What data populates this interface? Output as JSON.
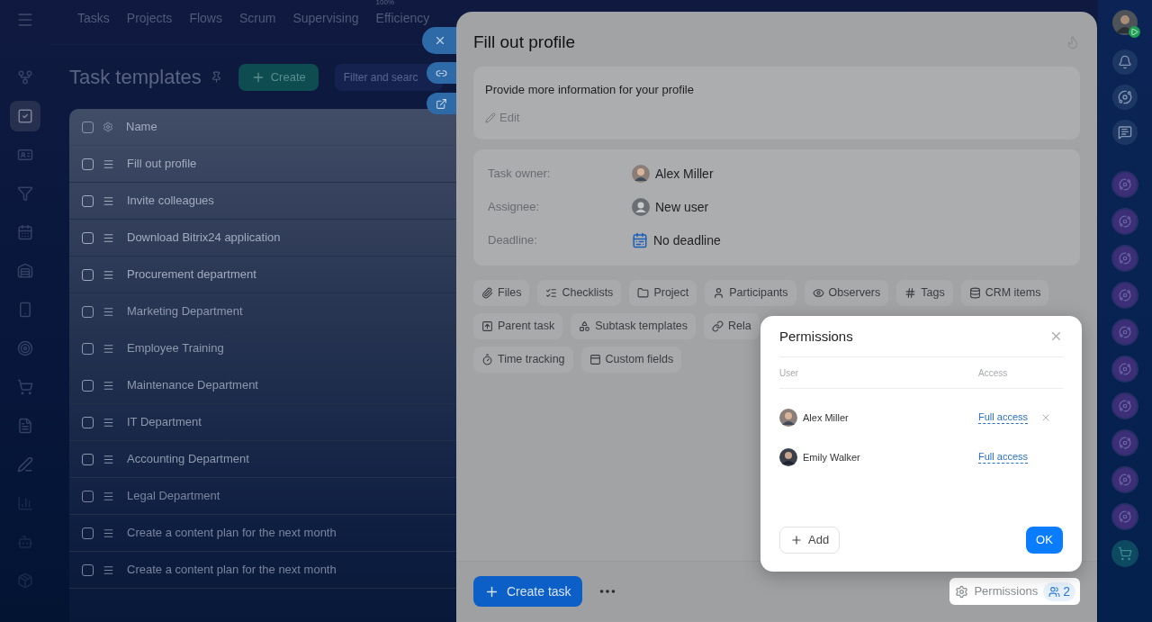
{
  "left_sidebar": {
    "items": [
      {
        "kind": "flow",
        "selected": false
      },
      {
        "kind": "tasks",
        "selected": true
      },
      {
        "kind": "card",
        "selected": false
      },
      {
        "kind": "funnel",
        "selected": false
      },
      {
        "kind": "calendar",
        "selected": false
      },
      {
        "kind": "store",
        "selected": false
      },
      {
        "kind": "phone",
        "selected": false
      },
      {
        "kind": "target",
        "selected": false
      },
      {
        "kind": "cart",
        "selected": false
      },
      {
        "kind": "doc",
        "selected": false
      },
      {
        "kind": "pen",
        "selected": false
      },
      {
        "kind": "chart",
        "selected": false
      },
      {
        "kind": "robot",
        "selected": false
      },
      {
        "kind": "box",
        "selected": false
      }
    ]
  },
  "top_nav": {
    "items": [
      {
        "label": "Tasks"
      },
      {
        "label": "Projects"
      },
      {
        "label": "Flows"
      },
      {
        "label": "Scrum"
      },
      {
        "label": "Supervising"
      },
      {
        "label": "Efficiency",
        "badge": "100%"
      }
    ]
  },
  "page": {
    "title": "Task templates",
    "create_button": "Create",
    "search": {
      "placeholder": "Filter and searc"
    }
  },
  "table": {
    "columns": [
      "Name"
    ],
    "all_checked": false,
    "rows": [
      {
        "name": "Fill out profile",
        "checked": false
      },
      {
        "name": "Invite colleagues",
        "checked": false
      },
      {
        "name": "Download Bitrix24 application",
        "checked": false
      },
      {
        "name": "Procurement department",
        "checked": false
      },
      {
        "name": "Marketing Department",
        "checked": false
      },
      {
        "name": "Employee Training",
        "checked": false
      },
      {
        "name": "Maintenance Department",
        "checked": false
      },
      {
        "name": "IT Department",
        "checked": false
      },
      {
        "name": "Accounting Department",
        "checked": false
      },
      {
        "name": "Legal Department",
        "checked": false
      },
      {
        "name": "Create a content plan for the next month",
        "checked": false
      },
      {
        "name": "Create a content plan for the next month",
        "checked": false
      }
    ]
  },
  "panel": {
    "title": "Fill out profile",
    "description": "Provide more information for your profile",
    "edit": "Edit",
    "fields": [
      {
        "label": "Task owner:",
        "value": "Alex Miller",
        "kind": "person"
      },
      {
        "label": "Assignee:",
        "value": "New user",
        "kind": "user"
      },
      {
        "label": "Deadline:",
        "value": "No deadline",
        "kind": "deadline"
      }
    ],
    "tag_rows": [
      [
        {
          "label": "Files",
          "kind": "clip"
        },
        {
          "label": "Checklists",
          "kind": "list"
        },
        {
          "label": "Project",
          "kind": "folder"
        },
        {
          "label": "Participants",
          "kind": "person"
        },
        {
          "label": "Observers",
          "kind": "eye"
        },
        {
          "label": "Tags",
          "kind": "hash"
        },
        {
          "label": "CRM items",
          "kind": "crm"
        }
      ],
      [
        {
          "label": "Parent task",
          "kind": "parent"
        },
        {
          "label": "Subtask templates",
          "kind": "subtask"
        },
        {
          "label": "Rela",
          "kind": "link"
        }
      ],
      [
        {
          "label": "Time tracking",
          "kind": "timer"
        },
        {
          "label": "Custom fields",
          "kind": "fields"
        }
      ]
    ],
    "create_task": "Create task",
    "permissions": "Permissions",
    "permissions_count": "2"
  },
  "dialog": {
    "title": "Permissions",
    "columns": [
      "User",
      "Access"
    ],
    "rows": [
      {
        "name": "Alex Miller",
        "access": "Full access",
        "removable": true
      },
      {
        "name": "Emily Walker",
        "access": "Full access",
        "removable": false
      }
    ],
    "add": "Add",
    "ok": "OK"
  },
  "right_sidebar": {
    "items": [
      {
        "kind": "bell"
      },
      {
        "kind": "copilot"
      },
      {
        "kind": "chat"
      },
      {
        "kind": "app"
      },
      {
        "kind": "app"
      },
      {
        "kind": "app"
      },
      {
        "kind": "app"
      },
      {
        "kind": "app"
      },
      {
        "kind": "app"
      },
      {
        "kind": "app"
      },
      {
        "kind": "app"
      },
      {
        "kind": "app"
      },
      {
        "kind": "app"
      },
      {
        "kind": "shop"
      }
    ]
  }
}
